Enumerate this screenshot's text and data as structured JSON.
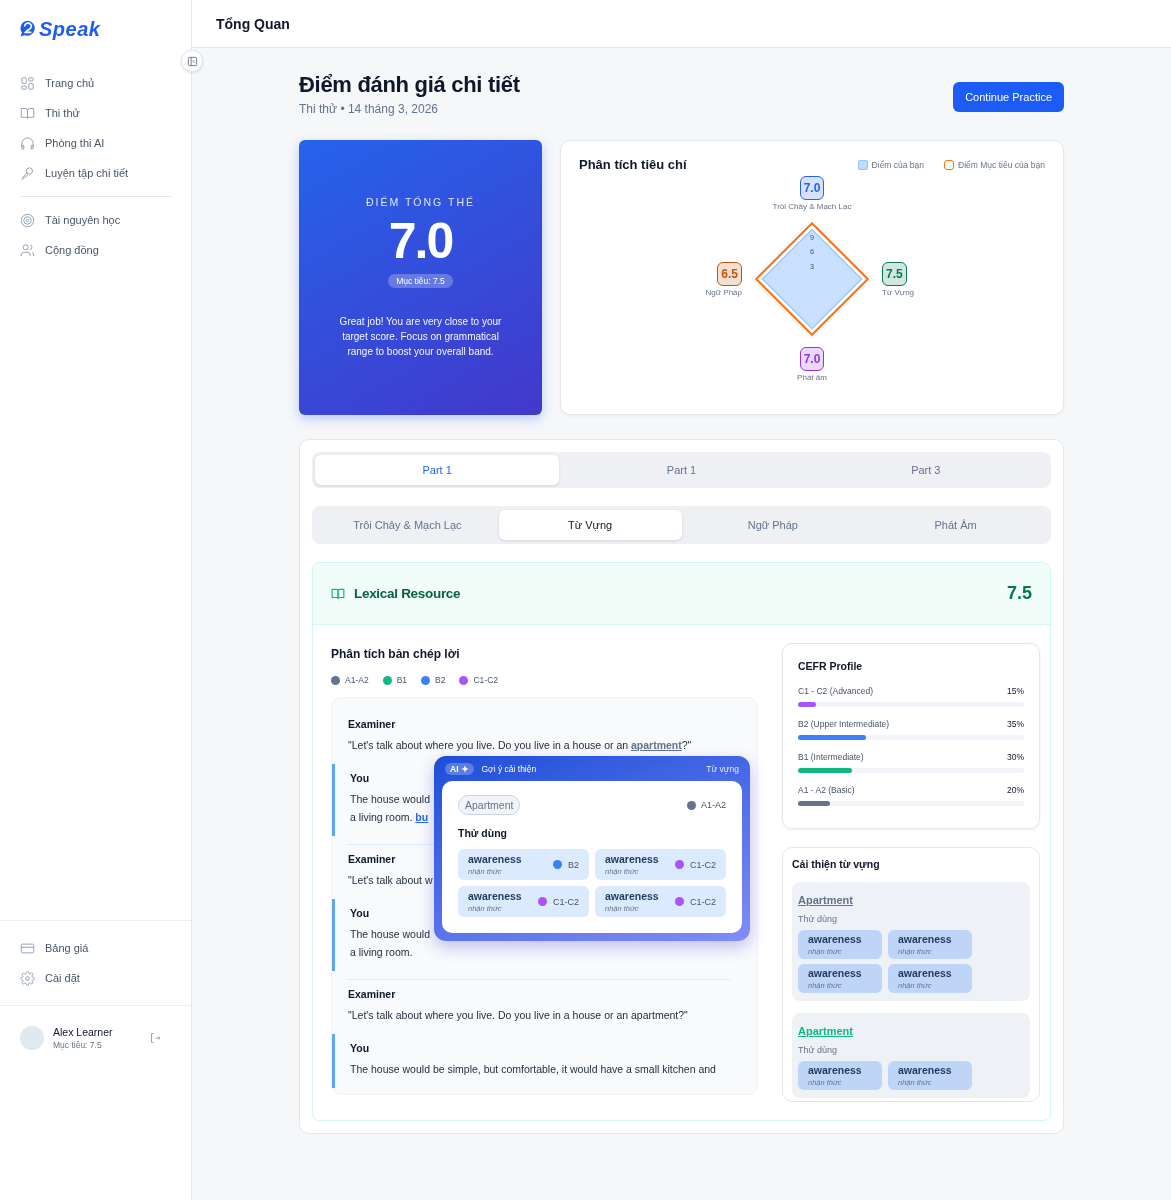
{
  "sidebar": {
    "logo": "Speak",
    "nav": [
      {
        "label": "Trang chủ"
      },
      {
        "label": "Thi thử"
      },
      {
        "label": "Phòng thi AI"
      },
      {
        "label": "Luyện tập chi tiết"
      }
    ],
    "nav2": [
      {
        "label": "Tài nguyên học"
      },
      {
        "label": "Cộng đồng"
      }
    ],
    "bottom": [
      {
        "label": "Bảng giá"
      },
      {
        "label": "Cài đặt"
      }
    ],
    "user": {
      "name": "Alex Learner",
      "target": "Mục tiêu: 7.5"
    }
  },
  "header": {
    "title": "Tổng Quan"
  },
  "page": {
    "title": "Điểm đánh giá chi tiết",
    "subtitle": "Thi thử • 14 tháng 3, 2026",
    "action": "Continue Practice"
  },
  "overall": {
    "label": "ĐIỂM TỔNG THỂ",
    "score": "7.0",
    "target": "Mục tiêu: 7.5",
    "message": "Great job! You are very close to your target score. Focus on grammatical range to boost your overall band."
  },
  "criteria_panel": {
    "title": "Phân tích tiêu chí",
    "legend": [
      {
        "label": "Điểm của bạn",
        "kind": "filled"
      },
      {
        "label": "Điểm Mục tiêu của bạn",
        "kind": "outline"
      }
    ],
    "ticks": [
      "9",
      "6",
      "3"
    ],
    "criteria": [
      {
        "label": "Trôi Chảy & Mạch Lạc",
        "score": "7.0",
        "color": "#2563eb"
      },
      {
        "label": "Ngữ Pháp",
        "score": "6.5",
        "color": "#c2570c"
      },
      {
        "label": "Từ Vựng",
        "score": "7.5",
        "color": "#047857"
      },
      {
        "label": "Phát âm",
        "score": "7.0",
        "color": "#9333ea"
      }
    ]
  },
  "part_tabs": [
    {
      "label": "Part 1",
      "selected": true
    },
    {
      "label": "Part 1",
      "selected": false
    },
    {
      "label": "Part 3",
      "selected": false
    }
  ],
  "criteria_tabs": [
    {
      "label": "Trôi Chảy & Mạch Lạc",
      "selected": false
    },
    {
      "label": "Từ Vựng",
      "selected": true
    },
    {
      "label": "Ngữ Pháp",
      "selected": false
    },
    {
      "label": "Phát Âm",
      "selected": false
    }
  ],
  "section": {
    "title": "Lexical Resource",
    "score": "7.5",
    "transcript": {
      "title": "Phân tích bản chép lời",
      "levels": [
        {
          "label": "A1-A2",
          "color": "#64748b"
        },
        {
          "label": "B1",
          "color": "#10b981"
        },
        {
          "label": "B2",
          "color": "#3b82f6"
        },
        {
          "label": "C1-C2",
          "color": "#a855f7"
        }
      ],
      "turns": [
        {
          "speaker": "Examiner",
          "kind": "examiner",
          "lines": [
            {
              "text": "\"Let's talk about where you live. Do you live in a house or an ",
              "link": "apartment",
              "color": "#64748b",
              "after": "?\""
            }
          ]
        },
        {
          "speaker": "You",
          "kind": "you",
          "lines": [
            {
              "text": "The house would"
            },
            {
              "text": "a living room. ",
              "link": "bu",
              "color": "#2563eb"
            }
          ]
        },
        {
          "speaker": "Examiner",
          "kind": "examiner",
          "lines": [
            {
              "text": "\"Let's talk about w"
            }
          ]
        },
        {
          "speaker": "You",
          "kind": "you",
          "lines": [
            {
              "text": "The house would"
            },
            {
              "text": "a living room."
            }
          ]
        },
        {
          "speaker": "Examiner",
          "kind": "examiner",
          "lines": [
            {
              "text": "\"Let's talk about where you live. Do you live in a house or an apartment?\""
            }
          ]
        },
        {
          "speaker": "You",
          "kind": "you",
          "lines": [
            {
              "text": "The house would be simple, but comfortable, it would have a small kitchen and"
            }
          ]
        }
      ]
    },
    "popup": {
      "badge": "AI",
      "title": "Gợi ý cải thiện",
      "category": "Từ vựng",
      "word": "Apartment",
      "level": "A1-A2",
      "color": "#64748b",
      "hint": "Thử dùng",
      "suggestions": [
        {
          "word": "awareness",
          "meaning": "nhận thức",
          "level": "B2",
          "color": "#3b82f6"
        },
        {
          "word": "awareness",
          "meaning": "nhận thức",
          "level": "C1-C2",
          "color": "#a855f7"
        },
        {
          "word": "awareness",
          "meaning": "nhận thức",
          "level": "C1-C2",
          "color": "#a855f7"
        },
        {
          "word": "awareness",
          "meaning": "nhận thức",
          "level": "C1-C2",
          "color": "#a855f7"
        }
      ]
    },
    "cefr": {
      "title": "CEFR Profile",
      "rows": [
        {
          "label": "C1 - C2 (Advanced)",
          "value": "15%",
          "level": 0.08,
          "color": "#a855f7"
        },
        {
          "label": "B2 (Upper Intermediate)",
          "value": "35%",
          "level": 0.3,
          "color": "#3b82f6"
        },
        {
          "label": "B1 (Intermediate)",
          "value": "30%",
          "level": 0.24,
          "color": "#10b981"
        },
        {
          "label": "A1 - A2 (Basic)",
          "value": "20%",
          "level": 0.14,
          "color": "#64748b"
        }
      ]
    },
    "vocab": {
      "title": "Cải thiện từ vựng",
      "groups": [
        {
          "word": "Apartment",
          "color": "#64748b",
          "hint": "Thử dùng",
          "suggestions": [
            {
              "word": "awareness",
              "meaning": "nhận thức"
            },
            {
              "word": "awareness",
              "meaning": "nhận thức"
            },
            {
              "word": "awareness",
              "meaning": "nhận thức"
            },
            {
              "word": "awareness",
              "meaning": "nhận thức"
            }
          ]
        },
        {
          "word": "Apartment",
          "color": "#10b981",
          "hint": "Thử dùng",
          "suggestions": [
            {
              "word": "awareness",
              "meaning": "nhận thức"
            },
            {
              "word": "awareness",
              "meaning": "nhận thức"
            }
          ]
        }
      ]
    }
  }
}
